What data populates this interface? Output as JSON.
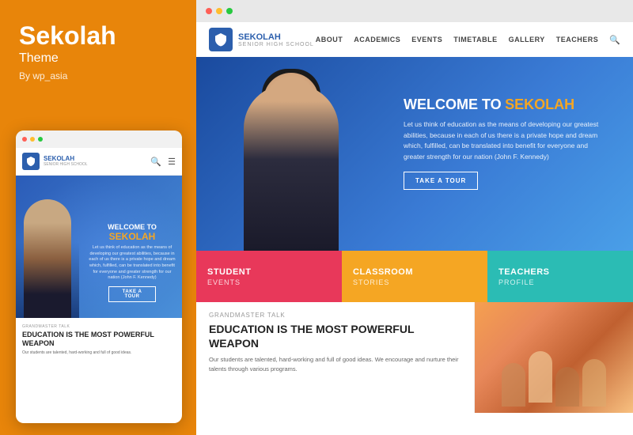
{
  "leftPanel": {
    "themeName": "Sekolah",
    "themeWord": "Theme",
    "author": "By wp_asia"
  },
  "mobileBrowser": {
    "dots": [
      "red",
      "yellow",
      "green"
    ]
  },
  "mobileHeader": {
    "logoText": "SEKOLAH",
    "logoSub": "SENIOR HIGH SCHOOL"
  },
  "mobileHero": {
    "welcomeLine1": "WELCOME TO",
    "welcomeLine2": "SEKOLAH",
    "description": "Let us think of education as the means of developing our greatest abilities, because in each of us there is a private hope and dream which, fulfilled, can be translated into benefit for everyone and greater strength for our nation (John F. Kennedy)",
    "ctaButton": "TAKE A TOUR"
  },
  "mobileBottom": {
    "label": "Grandmaster Talk",
    "title": "EDUCATION IS THE MOST POWERFUL WEAPON",
    "body": "Our students are talented, hard-working and full of good ideas."
  },
  "desktopBrowser": {
    "dots": [
      "red",
      "yellow",
      "green"
    ]
  },
  "siteHeader": {
    "logoText": "SEKOLAH",
    "logoSub": "SENIOR HIGH SCHOOL",
    "navItems": [
      "ABOUT",
      "ACADEMICS",
      "EVENTS",
      "TIMETABLE",
      "GALLERY",
      "TEACHERS"
    ]
  },
  "siteHero": {
    "welcomeText": "WELCOME TO",
    "brandText": "SEKOLAH",
    "description": "Let us think of education as the means of developing our greatest abilities, because in each of us there is a private hope and dream which, fulfilled, can be translated into benefit for everyone and greater strength for our nation (John F. Kennedy)",
    "ctaButton": "TAKE A TOUR"
  },
  "cards": [
    {
      "title": "STUDENT",
      "subtitle": "EVENTS"
    },
    {
      "title": "CLASSROOM",
      "subtitle": "STORIES"
    },
    {
      "title": "TEACHERS",
      "subtitle": "PROFILE"
    }
  ],
  "bottomSection": {
    "label": "Grandmaster Talk",
    "title": "EDUCATION IS THE MOST POWERFUL WEAPON",
    "body": "Our students are talented, hard-working and full of good ideas. We encourage and nurture their talents through various programs."
  }
}
